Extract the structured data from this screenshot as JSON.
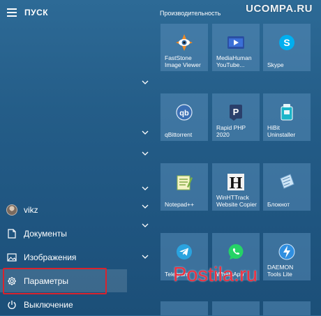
{
  "start": {
    "title": "ПУСК"
  },
  "nav": {
    "user": "vikz",
    "documents": "Документы",
    "pictures": "Изображения",
    "settings": "Параметры",
    "power": "Выключение"
  },
  "group": {
    "title": "Производительность"
  },
  "tiles": [
    {
      "label": "FastStone Image Viewer",
      "icon": "faststone-icon"
    },
    {
      "label": "MediaHuman YouTube...",
      "icon": "mediahuman-icon"
    },
    {
      "label": "Skype",
      "icon": "skype-icon"
    },
    {
      "label": "qBittorrent",
      "icon": "qbittorrent-icon"
    },
    {
      "label": "Rapid PHP 2020",
      "icon": "rapid-php-icon"
    },
    {
      "label": "HiBit Uninstaller",
      "icon": "hibit-icon"
    },
    {
      "label": "Notepad++",
      "icon": "notepadpp-icon"
    },
    {
      "label": "WinHTTrack Website Copier",
      "icon": "winhttrack-icon"
    },
    {
      "label": "Блокнот",
      "icon": "notepad-icon"
    },
    {
      "label": "Telegram",
      "icon": "telegram-icon"
    },
    {
      "label": "WhatsApp",
      "icon": "whatsapp-icon"
    },
    {
      "label": "DAEMON Tools Lite",
      "icon": "daemon-tools-icon"
    }
  ],
  "watermark": {
    "top": "UCOMPA.RU",
    "bottom": "Postila.ru"
  },
  "colors": {
    "highlight": "#d9232d",
    "background": "#245d88"
  }
}
